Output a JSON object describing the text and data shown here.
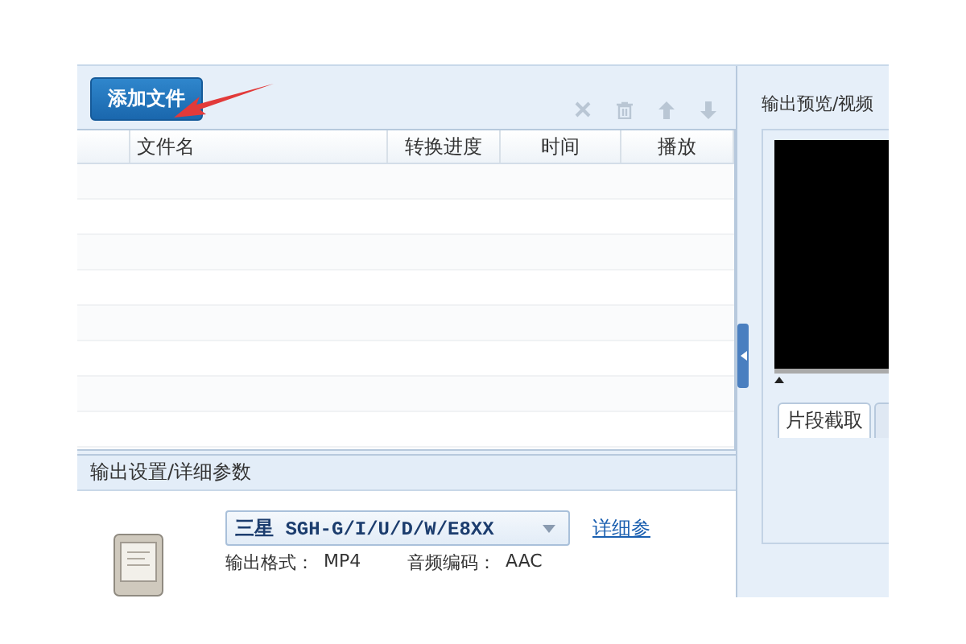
{
  "toolbar": {
    "add_button": "添加文件"
  },
  "file_table": {
    "columns": [
      "文件名",
      "转换进度",
      "时间",
      "播放"
    ]
  },
  "preview": {
    "title": "输出预览/视频"
  },
  "preview_tabs": [
    {
      "label": "片段截取",
      "selected": true
    }
  ],
  "output_settings": {
    "title": "输出设置/详细参数",
    "device": "三星 SGH-G/I/U/D/W/E8XX",
    "details_link": "详细参",
    "format_label": "输出格式：",
    "format": "MP4",
    "audio_label": "音频编码：",
    "audio": "AAC"
  }
}
